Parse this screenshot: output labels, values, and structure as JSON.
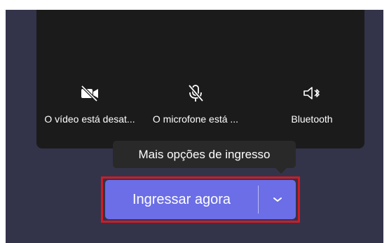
{
  "controls": {
    "video": {
      "label": "O vídeo está desat...",
      "icon": "camera-off-icon"
    },
    "microphone": {
      "label": "O microfone está ...",
      "icon": "microphone-off-icon"
    },
    "audio": {
      "label": "Bluetooth",
      "icon": "bluetooth-speaker-icon"
    }
  },
  "tooltip": {
    "text": "Mais opções de ingresso"
  },
  "join": {
    "label": "Ingressar agora",
    "dropdown_icon": "chevron-down-icon"
  },
  "colors": {
    "background": "#33344a",
    "video_panel": "#1b1b1b",
    "join_button": "#6b6ee6",
    "tooltip": "#292929",
    "highlight": "#d21a24"
  }
}
